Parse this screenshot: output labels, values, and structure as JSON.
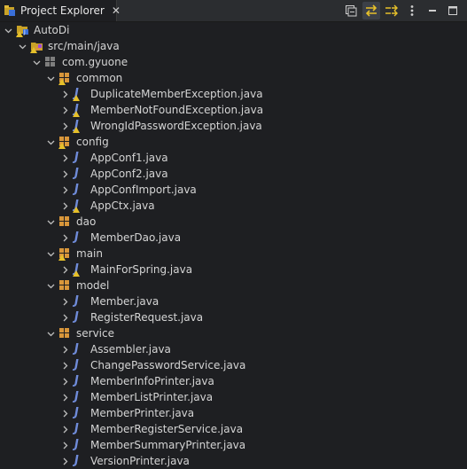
{
  "tab": {
    "title": "Project Explorer",
    "close": "✕"
  },
  "toolbar": {
    "buttons": [
      {
        "name": "collapse-all-icon",
        "active": false
      },
      {
        "name": "link-with-editor-icon",
        "active": true
      },
      {
        "name": "filters-icon",
        "active": false
      },
      {
        "name": "view-menu-icon",
        "active": false
      },
      {
        "name": "minimize-icon",
        "active": false
      },
      {
        "name": "maximize-icon",
        "active": false
      }
    ]
  },
  "tree": {
    "items": [
      {
        "label": "AutoDi",
        "level": 0,
        "expanded": true,
        "icon": "project",
        "warn": true
      },
      {
        "label": "src/main/java",
        "level": 1,
        "expanded": true,
        "icon": "source-folder",
        "warn": true
      },
      {
        "label": "com.gyuone",
        "level": 2,
        "expanded": true,
        "icon": "package-empty",
        "warn": false
      },
      {
        "label": "common",
        "level": 3,
        "expanded": true,
        "icon": "package",
        "warn": true
      },
      {
        "label": "DuplicateMemberException.java",
        "level": 4,
        "expanded": false,
        "icon": "java",
        "warn": true
      },
      {
        "label": "MemberNotFoundException.java",
        "level": 4,
        "expanded": false,
        "icon": "java",
        "warn": true
      },
      {
        "label": "WrongIdPasswordException.java",
        "level": 4,
        "expanded": false,
        "icon": "java",
        "warn": true
      },
      {
        "label": "config",
        "level": 3,
        "expanded": true,
        "icon": "package",
        "warn": true
      },
      {
        "label": "AppConf1.java",
        "level": 4,
        "expanded": false,
        "icon": "java",
        "warn": false
      },
      {
        "label": "AppConf2.java",
        "level": 4,
        "expanded": false,
        "icon": "java",
        "warn": false
      },
      {
        "label": "AppConfImport.java",
        "level": 4,
        "expanded": false,
        "icon": "java",
        "warn": false
      },
      {
        "label": "AppCtx.java",
        "level": 4,
        "expanded": false,
        "icon": "java",
        "warn": true
      },
      {
        "label": "dao",
        "level": 3,
        "expanded": true,
        "icon": "package",
        "warn": false
      },
      {
        "label": "MemberDao.java",
        "level": 4,
        "expanded": false,
        "icon": "java",
        "warn": false
      },
      {
        "label": "main",
        "level": 3,
        "expanded": true,
        "icon": "package",
        "warn": true
      },
      {
        "label": "MainForSpring.java",
        "level": 4,
        "expanded": false,
        "icon": "java",
        "warn": true
      },
      {
        "label": "model",
        "level": 3,
        "expanded": true,
        "icon": "package",
        "warn": false
      },
      {
        "label": "Member.java",
        "level": 4,
        "expanded": false,
        "icon": "java",
        "warn": false
      },
      {
        "label": "RegisterRequest.java",
        "level": 4,
        "expanded": false,
        "icon": "java",
        "warn": false
      },
      {
        "label": "service",
        "level": 3,
        "expanded": true,
        "icon": "package",
        "warn": false
      },
      {
        "label": "Assembler.java",
        "level": 4,
        "expanded": false,
        "icon": "java",
        "warn": false
      },
      {
        "label": "ChangePasswordService.java",
        "level": 4,
        "expanded": false,
        "icon": "java",
        "warn": false
      },
      {
        "label": "MemberInfoPrinter.java",
        "level": 4,
        "expanded": false,
        "icon": "java",
        "warn": false
      },
      {
        "label": "MemberListPrinter.java",
        "level": 4,
        "expanded": false,
        "icon": "java",
        "warn": false
      },
      {
        "label": "MemberPrinter.java",
        "level": 4,
        "expanded": false,
        "icon": "java",
        "warn": false
      },
      {
        "label": "MemberRegisterService.java",
        "level": 4,
        "expanded": false,
        "icon": "java",
        "warn": false
      },
      {
        "label": "MemberSummaryPrinter.java",
        "level": 4,
        "expanded": false,
        "icon": "java",
        "warn": false
      },
      {
        "label": "VersionPrinter.java",
        "level": 4,
        "expanded": false,
        "icon": "java",
        "warn": false
      }
    ]
  },
  "colors": {
    "background": "#1e1f22",
    "header": "#2b2d30",
    "accent": "#e6c02a",
    "java": "#6f8bd8",
    "package": "#d8963a"
  }
}
